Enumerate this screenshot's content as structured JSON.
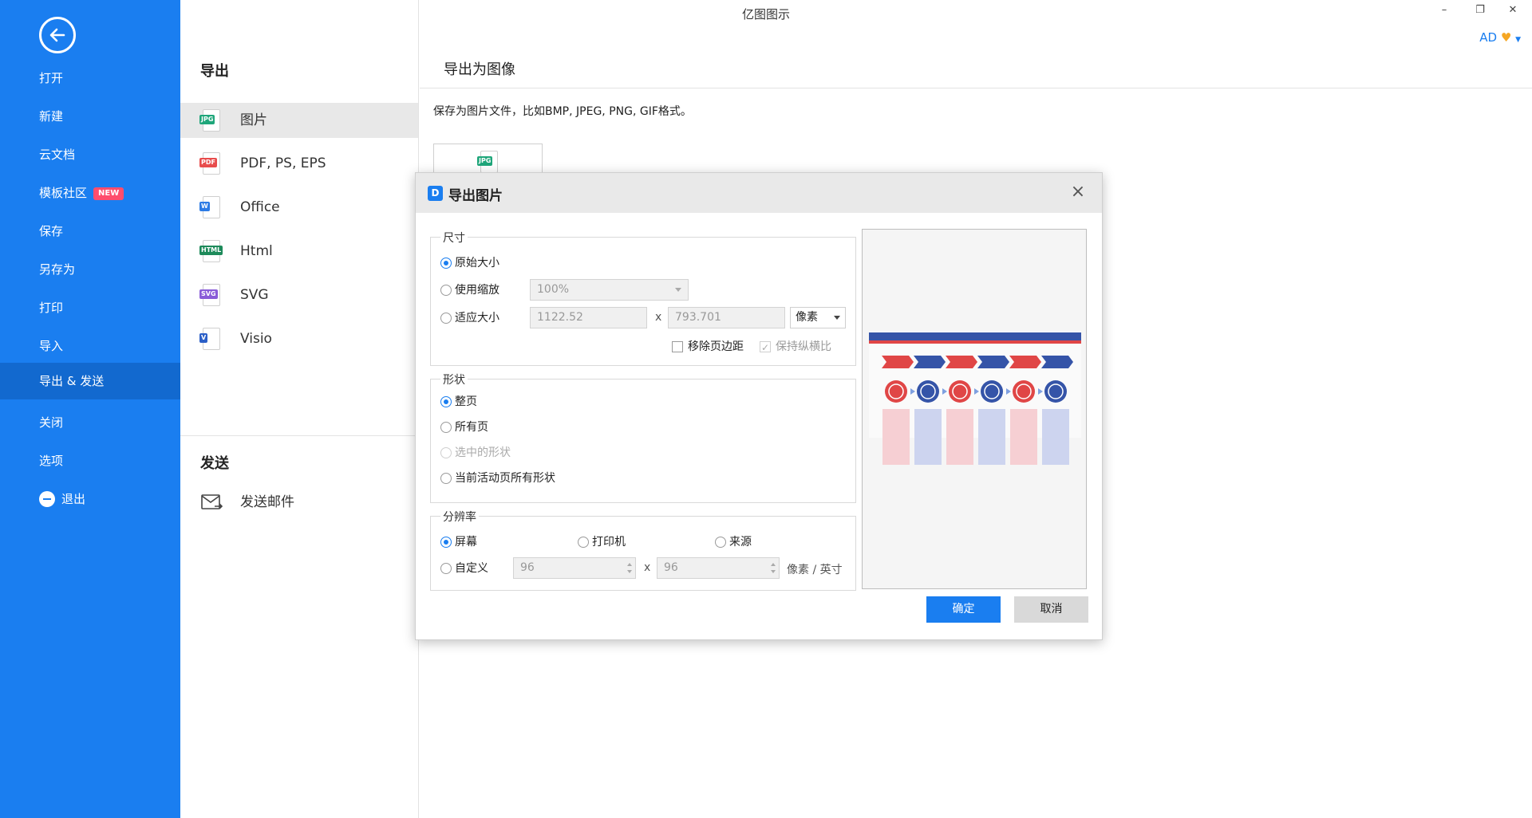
{
  "app": {
    "title": "亿图图示",
    "user": "AD"
  },
  "window_controls": {
    "minimize": "–",
    "restore": "❐",
    "close": "✕"
  },
  "sidebar": {
    "items": [
      {
        "label": "打开"
      },
      {
        "label": "新建"
      },
      {
        "label": "云文档"
      },
      {
        "label": "模板社区",
        "badge": "NEW"
      },
      {
        "label": "保存"
      },
      {
        "label": "另存为"
      },
      {
        "label": "打印"
      },
      {
        "label": "导入"
      },
      {
        "label": "导出 & 发送",
        "active": true
      },
      {
        "label": "关闭"
      },
      {
        "label": "选项"
      },
      {
        "label": "退出"
      }
    ]
  },
  "export_panel": {
    "title": "导出",
    "items": [
      {
        "label": "图片",
        "tag": "JPG",
        "color": "#1fa67a",
        "active": true
      },
      {
        "label": "PDF, PS, EPS",
        "tag": "PDF",
        "color": "#e84c4c"
      },
      {
        "label": "Office",
        "tag": "W",
        "color": "#2d7be5"
      },
      {
        "label": "Html",
        "tag": "HTML",
        "color": "#1d8a5a"
      },
      {
        "label": "SVG",
        "tag": "SVG",
        "color": "#8a5cd8"
      },
      {
        "label": "Visio",
        "tag": "V",
        "color": "#2b5fc7"
      }
    ],
    "send_title": "发送",
    "send_mail": "发送邮件"
  },
  "content": {
    "title": "导出为图像",
    "description": "保存为图片文件，比如BMP, JPEG, PNG, GIF格式。",
    "card_tag": "JPG"
  },
  "dialog": {
    "logo": "D",
    "title": "导出图片",
    "size_group": {
      "label": "尺寸",
      "original": "原始大小",
      "use_zoom": "使用缩放",
      "zoom_value": "100%",
      "fit_size": "适应大小",
      "width": "1122.52",
      "height": "793.701",
      "times": "x",
      "unit": "像素",
      "remove_margin": "移除页边距",
      "keep_ratio": "保持纵横比"
    },
    "shape_group": {
      "label": "形状",
      "whole_page": "整页",
      "all_pages": "所有页",
      "selected": "选中的形状",
      "current_all": "当前活动页所有形状"
    },
    "resolution_group": {
      "label": "分辨率",
      "screen": "屏幕",
      "printer": "打印机",
      "source": "来源",
      "custom": "自定义",
      "dpi_x": "96",
      "dpi_y": "96",
      "times": "x",
      "unit": "像素 / 英寸"
    },
    "ok": "确定",
    "cancel": "取消"
  },
  "colors": {
    "accent": "#1a7ef0",
    "sidebar_active": "#1269cf",
    "badge": "#ff4d6d"
  }
}
